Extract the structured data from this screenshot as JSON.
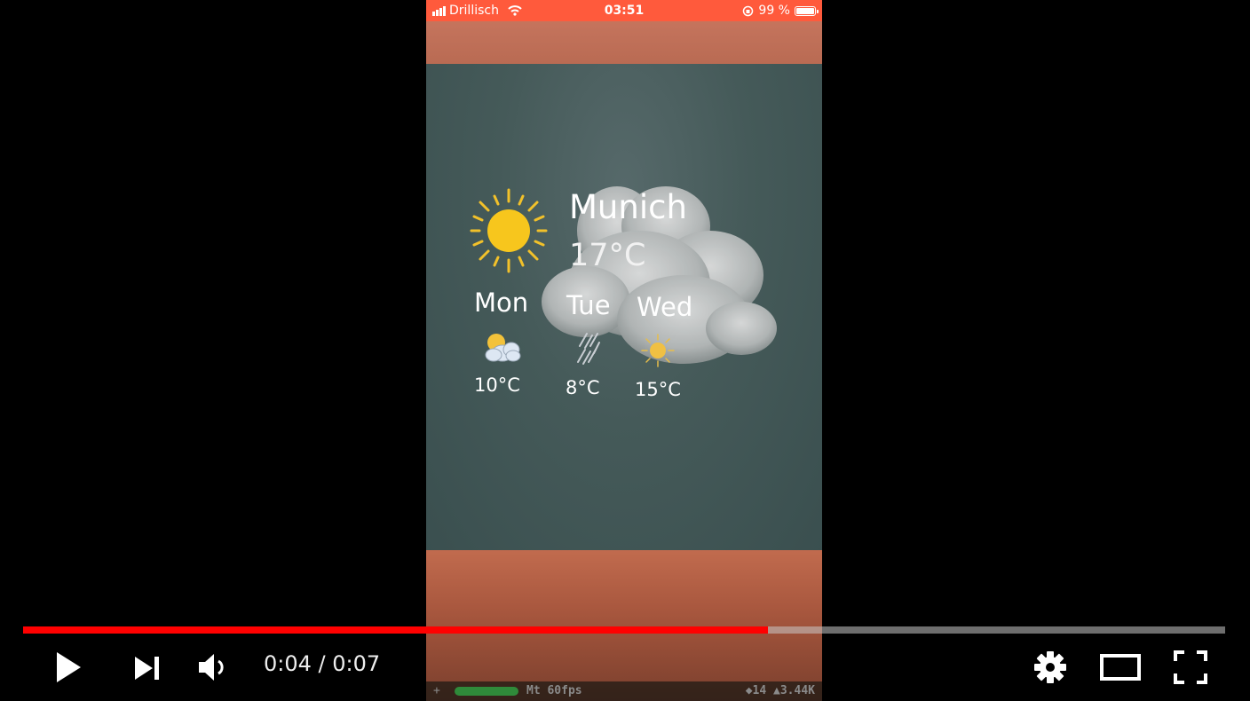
{
  "status_bar": {
    "carrier": "Drillisch",
    "time": "03:51",
    "battery": "99 %",
    "battery_level": 0.99
  },
  "weather": {
    "city": "Munich",
    "current_temp": "17°C",
    "current_icon": "sun-icon",
    "forecast": [
      {
        "day": "Mon",
        "temp": "10°C",
        "icon": "partly-cloudy-icon"
      },
      {
        "day": "Tue",
        "temp": "8°C",
        "icon": "rain-icon"
      },
      {
        "day": "Wed",
        "temp": "15°C",
        "icon": "sun-icon"
      }
    ]
  },
  "debug": {
    "plus": "+",
    "fps": "Mt 60fps",
    "stats": "◆14 ▲3.44K"
  },
  "player": {
    "current_time": "0:04",
    "separator": " / ",
    "duration": "0:07",
    "progress": 0.62,
    "colors": {
      "progress": "#ff0000",
      "track": "#c8c8c8"
    },
    "icons": [
      "play-icon",
      "next-icon",
      "volume-icon",
      "settings-icon",
      "theater-mode-icon",
      "fullscreen-icon"
    ]
  }
}
